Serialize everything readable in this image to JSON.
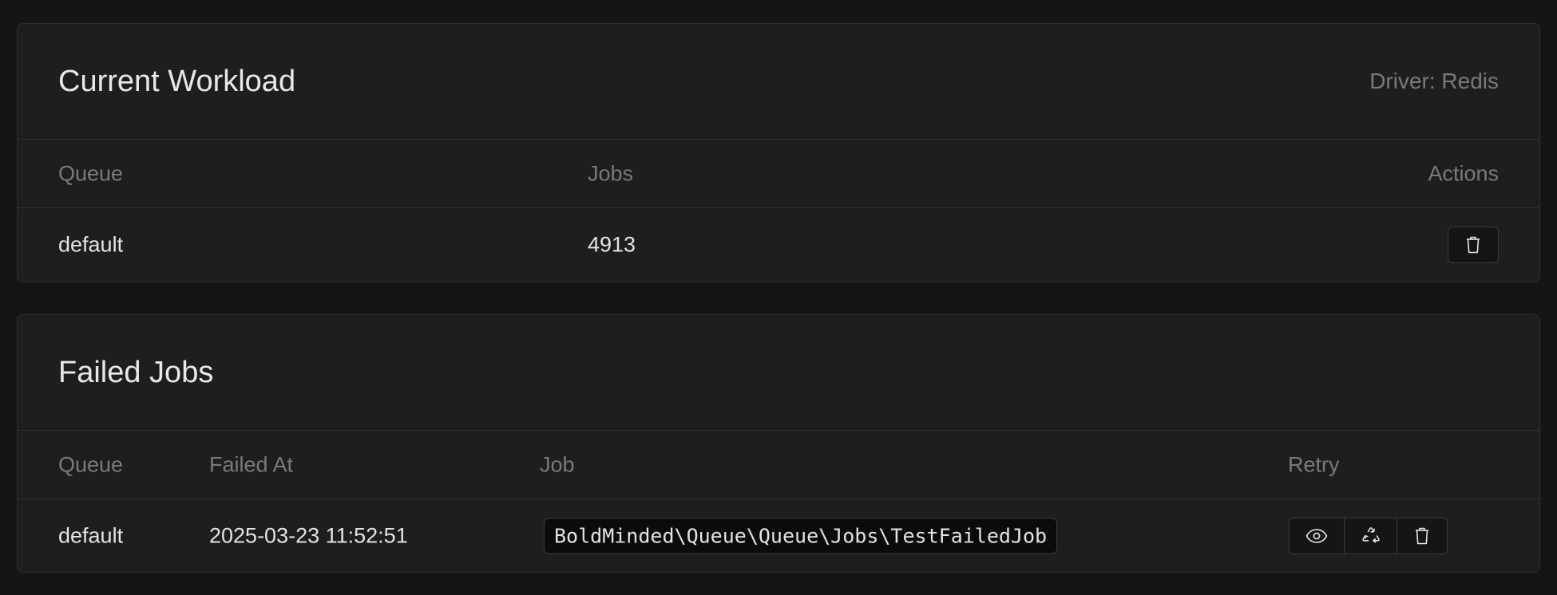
{
  "workload": {
    "title": "Current Workload",
    "driver": "Driver: Redis",
    "columns": {
      "queue": "Queue",
      "jobs": "Jobs",
      "actions": "Actions"
    },
    "rows": [
      {
        "queue": "default",
        "jobs": "4913",
        "action_icon": "trash-icon"
      }
    ]
  },
  "failed": {
    "title": "Failed Jobs",
    "columns": {
      "queue": "Queue",
      "failed_at": "Failed At",
      "job": "Job",
      "retry": "Retry"
    },
    "rows": [
      {
        "queue": "default",
        "failed_at": "2025-03-23 11:52:51",
        "job": "BoldMinded\\Queue\\Queue\\Jobs\\TestFailedJob",
        "actions": [
          "eye-icon",
          "recycle-icon",
          "trash-icon"
        ]
      }
    ]
  }
}
